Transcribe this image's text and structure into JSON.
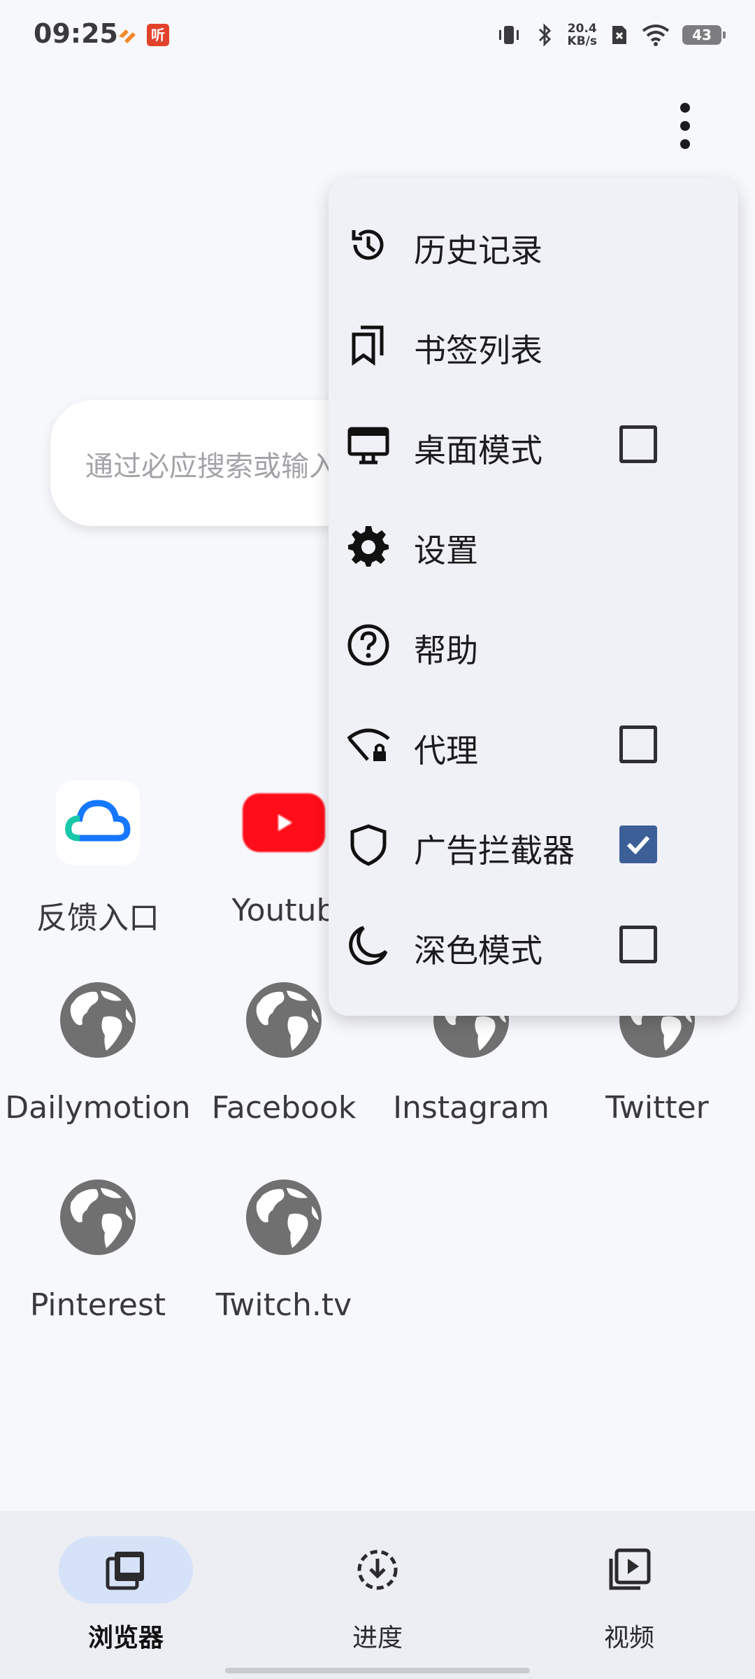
{
  "status_bar": {
    "time": "09:25",
    "app_badge": "听",
    "net_speed_value": "20.4",
    "net_speed_unit": "KB/s",
    "battery": "43"
  },
  "search": {
    "placeholder": "通过必应搜索或输入"
  },
  "shortcuts": [
    {
      "label": "反馈入口",
      "icon": "cloud-icon"
    },
    {
      "label": "Youtub",
      "icon": "youtube-icon"
    },
    {
      "label": "Dailymotion",
      "icon": "globe-icon"
    },
    {
      "label": "Facebook",
      "icon": "globe-icon"
    },
    {
      "label": "Instagram",
      "icon": "globe-icon"
    },
    {
      "label": "Twitter",
      "icon": "globe-icon"
    },
    {
      "label": "Pinterest",
      "icon": "globe-icon"
    },
    {
      "label": "Twitch.tv",
      "icon": "globe-icon"
    }
  ],
  "menu": {
    "items": [
      {
        "label": "历史记录",
        "icon": "history-icon"
      },
      {
        "label": "书签列表",
        "icon": "bookmarks-icon"
      },
      {
        "label": "桌面模式",
        "icon": "desktop-icon",
        "checked": false
      },
      {
        "label": "设置",
        "icon": "gear-icon"
      },
      {
        "label": "帮助",
        "icon": "help-icon"
      },
      {
        "label": "代理",
        "icon": "proxy-icon",
        "checked": false
      },
      {
        "label": "广告拦截器",
        "icon": "shield-icon",
        "checked": true
      },
      {
        "label": "深色模式",
        "icon": "moon-icon",
        "checked": false
      }
    ]
  },
  "bottom_nav": {
    "items": [
      {
        "label": "浏览器",
        "icon": "browser-tabs-icon",
        "active": true
      },
      {
        "label": "进度",
        "icon": "download-progress-icon",
        "active": false
      },
      {
        "label": "视频",
        "icon": "video-library-icon",
        "active": false
      }
    ]
  },
  "colors": {
    "accent": "#3d5f97",
    "nav_active_pill": "#d6e2f7",
    "youtube_red": "#ff0d18"
  }
}
